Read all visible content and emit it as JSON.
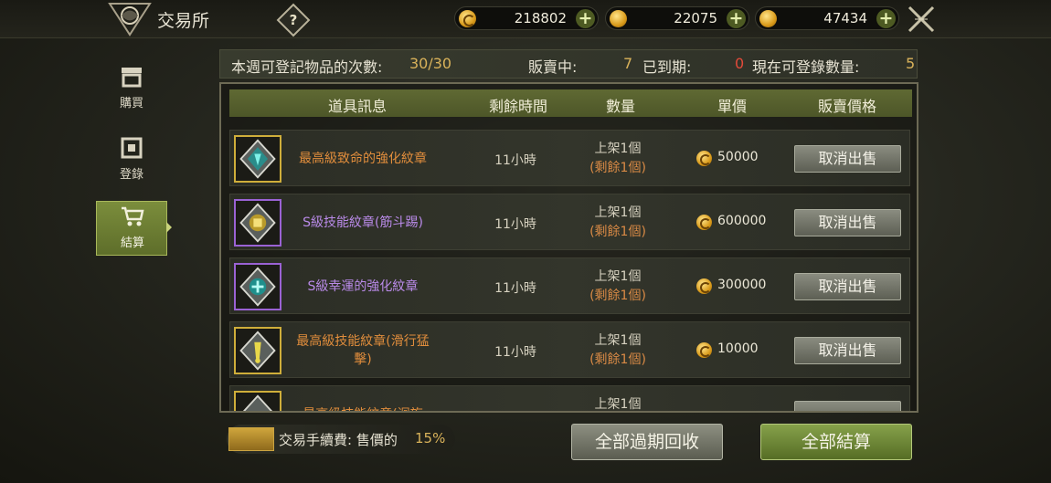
{
  "header": {
    "title": "交易所",
    "help_label": "?",
    "currencies": [
      {
        "icon": "silver-coin-icon",
        "value": "218802",
        "plus": "+"
      },
      {
        "icon": "gold-bag-icon",
        "value": "22075",
        "plus": "+"
      },
      {
        "icon": "gold-coin-icon",
        "value": "47434",
        "plus": "+"
      }
    ]
  },
  "sidebar": {
    "items": [
      {
        "label": "購買",
        "icon": "shop-icon",
        "active": false
      },
      {
        "label": "登錄",
        "icon": "building-icon",
        "active": false
      },
      {
        "label": "結算",
        "icon": "cart-icon",
        "active": true
      }
    ]
  },
  "stats": {
    "weekly_label": "本週可登記物品的次數:",
    "weekly_value": "30/30",
    "selling_label": "販賣中:",
    "selling_value": "7",
    "expired_label": "已到期:",
    "expired_value": "0",
    "available_label": "現在可登錄數量:",
    "available_value": "5"
  },
  "table": {
    "headers": [
      "道具訊息",
      "剩餘時間",
      "數量",
      "單價",
      "販賣價格"
    ],
    "rows": [
      {
        "name": "最高級致命的強化紋章",
        "rarity": "gold",
        "time": "11小時",
        "qty_listed": "上架1個",
        "qty_left": "(剩餘1個)",
        "price": "50000",
        "action": "取消出售"
      },
      {
        "name": "S級技能紋章(筋斗踢)",
        "rarity": "purple",
        "time": "11小時",
        "qty_listed": "上架1個",
        "qty_left": "(剩餘1個)",
        "price": "600000",
        "action": "取消出售"
      },
      {
        "name": "S級幸運的強化紋章",
        "rarity": "purple",
        "time": "11小時",
        "qty_listed": "上架1個",
        "qty_left": "(剩餘1個)",
        "price": "300000",
        "action": "取消出售"
      },
      {
        "name": "最高級技能紋章(滑行猛擊)",
        "rarity": "gold",
        "time": "11小時",
        "qty_listed": "上架1個",
        "qty_left": "(剩餘1個)",
        "price": "10000",
        "action": "取消出售"
      },
      {
        "name": "最高級技能紋章(迴旋",
        "rarity": "gold",
        "time": "",
        "qty_listed": "上架1個",
        "qty_left": "",
        "price": "",
        "action": ""
      }
    ]
  },
  "footer": {
    "fee_label": "交易手續費: 售價的",
    "fee_value": "15%",
    "reclaim_button": "全部過期回收",
    "settle_button": "全部結算"
  },
  "colors": {
    "accent_green": "#5e6e2a",
    "gold_text": "#e08d3c",
    "purple_text": "#b98ae8",
    "yellow_value": "#d9b25a",
    "red_value": "#e24a3a"
  }
}
